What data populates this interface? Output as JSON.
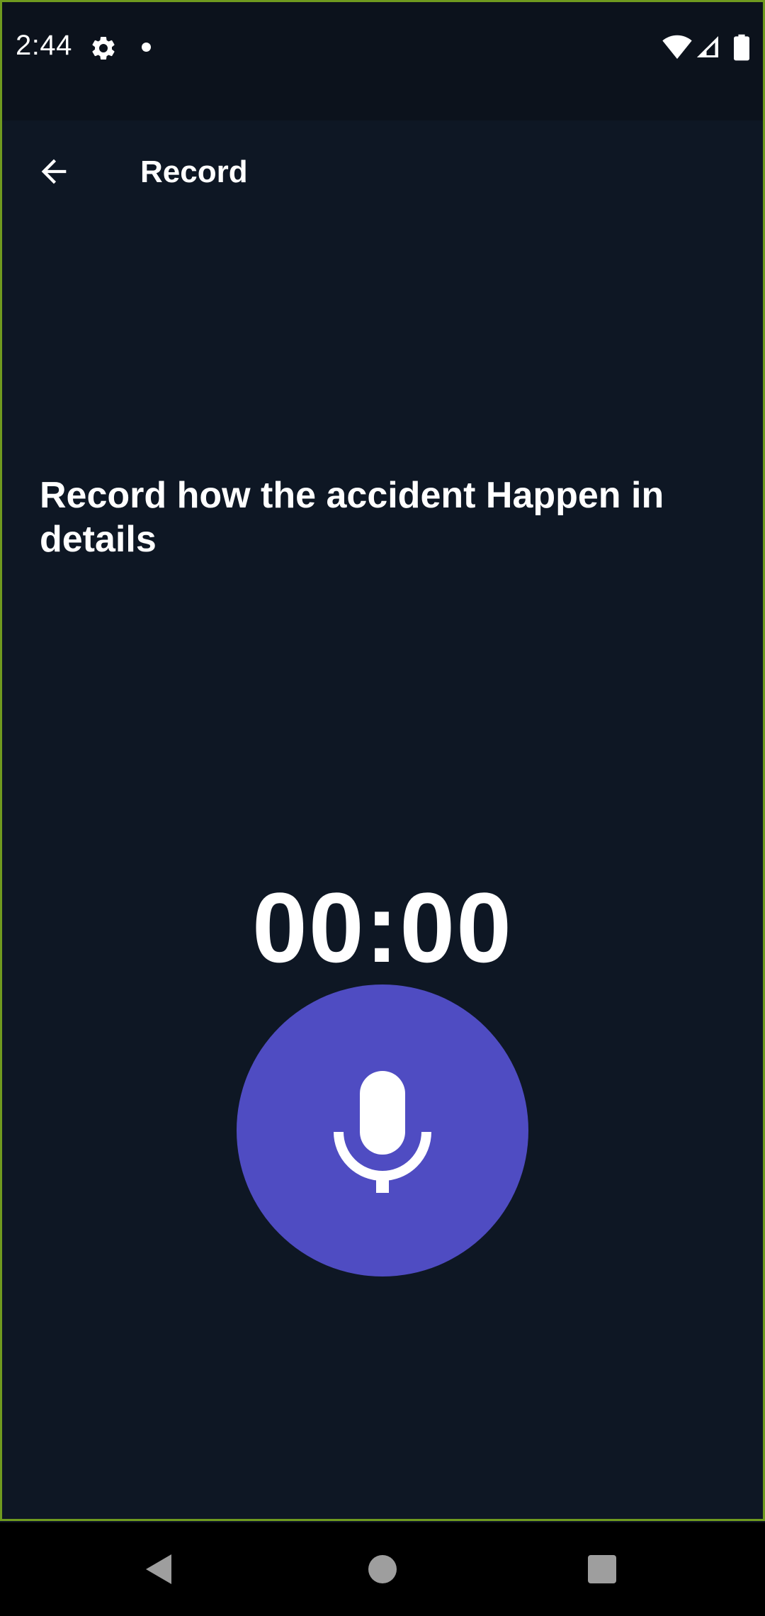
{
  "status_bar": {
    "time": "2:44",
    "icons": [
      "settings-gear-icon",
      "notification-dot-icon",
      "wifi-icon",
      "cell-signal-icon",
      "battery-icon"
    ]
  },
  "app_bar": {
    "title": "Record",
    "back_icon": "arrow-back-icon"
  },
  "prompt": {
    "text": "Record how the accident Happen in details"
  },
  "recorder": {
    "timer": "00:00",
    "mic_icon": "microphone-icon",
    "button_color": "#4f4cc2"
  },
  "navigation": {
    "back_icon": "nav-back-triangle-icon",
    "home_icon": "nav-home-circle-icon",
    "recents_icon": "nav-recents-square-icon"
  },
  "colors": {
    "background": "#0e1724",
    "status_bar": "#0c121c",
    "accent": "#4f4cc2",
    "text": "#ffffff"
  }
}
